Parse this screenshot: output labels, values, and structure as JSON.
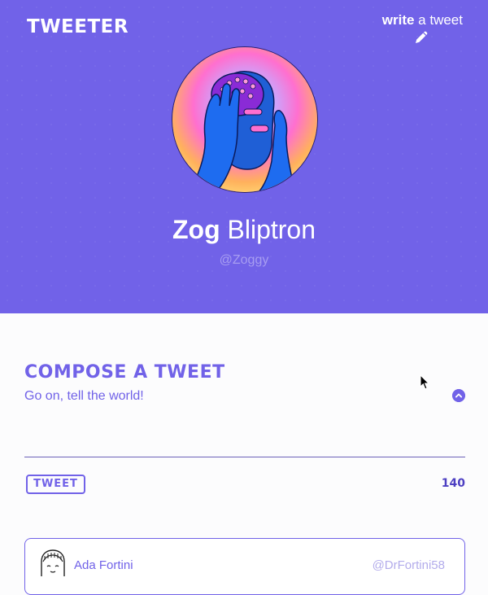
{
  "app": {
    "logo": "TWEETER"
  },
  "header": {
    "write_strong": "write",
    "write_rest": " a tweet",
    "pencil_icon": "pencil-icon"
  },
  "profile": {
    "first_name": "Zog",
    "last_name": " Bliptron",
    "handle": "@Zoggy"
  },
  "compose": {
    "title": "COMPOSE A TWEET",
    "placeholder": "Go on, tell the world!",
    "toggle_icon": "chevron-up-icon",
    "tweet_button": "TWEET",
    "char_count": "140"
  },
  "tweets": [
    {
      "name": "Ada Fortini",
      "handle": "@DrFortini58"
    }
  ],
  "colors": {
    "accent": "#7162e8",
    "header_bg": "#7162e8",
    "handle_muted": "#a79df1",
    "page_bg": "#fcfcfd"
  }
}
